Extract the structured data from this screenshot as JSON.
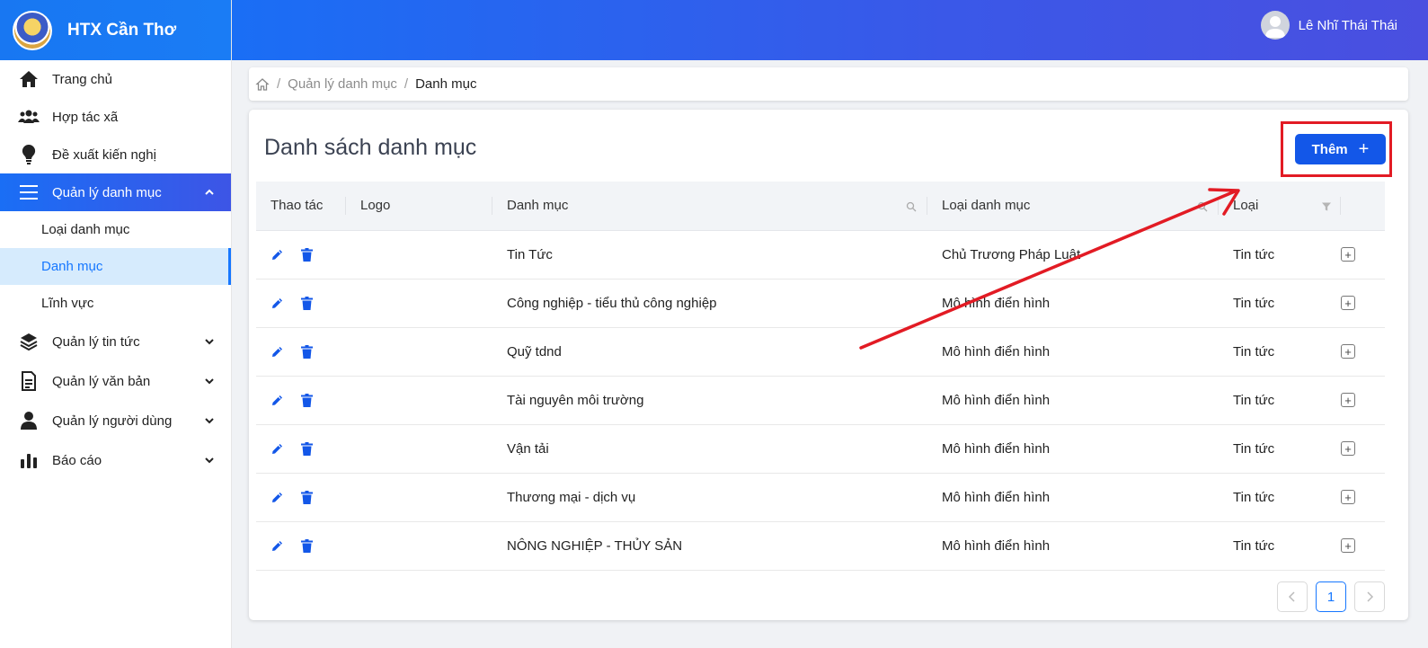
{
  "brand": {
    "title": "HTX Cần Thơ"
  },
  "user": {
    "name": "Lê Nhĩ Thái Thái"
  },
  "sidebar": {
    "items": [
      {
        "label": "Trang chủ",
        "icon": "home-icon"
      },
      {
        "label": "Hợp tác xã",
        "icon": "users-icon"
      },
      {
        "label": "Đề xuất kiến nghị",
        "icon": "lightbulb-icon"
      },
      {
        "label": "Quản lý danh mục",
        "icon": "menu-icon",
        "expanded": true,
        "children": [
          {
            "label": "Loại danh mục"
          },
          {
            "label": "Danh mục",
            "selected": true
          },
          {
            "label": "Lĩnh vực"
          }
        ]
      },
      {
        "label": "Quản lý tin tức",
        "icon": "layers-icon"
      },
      {
        "label": "Quản lý văn bản",
        "icon": "document-icon"
      },
      {
        "label": "Quản lý người dùng",
        "icon": "user-icon"
      },
      {
        "label": "Báo cáo",
        "icon": "bar-chart-icon"
      }
    ]
  },
  "breadcrumb": {
    "items": [
      "Quản lý danh mục",
      "Danh mục"
    ]
  },
  "main": {
    "title": "Danh sách danh mục",
    "add_label": "Thêm",
    "columns": [
      "Thao tác",
      "Logo",
      "Danh mục",
      "Loại danh mục",
      "Loại"
    ],
    "rows": [
      {
        "danh_muc": "Tin Tức",
        "loai_danh_muc": "Chủ Trương Pháp Luật",
        "loai": "Tin tức"
      },
      {
        "danh_muc": "Công nghiệp - tiểu thủ công nghiệp",
        "loai_danh_muc": "Mô hình điển hình",
        "loai": "Tin tức"
      },
      {
        "danh_muc": "Quỹ tdnd",
        "loai_danh_muc": "Mô hình điển hình",
        "loai": "Tin tức"
      },
      {
        "danh_muc": "Tài nguyên môi trường",
        "loai_danh_muc": "Mô hình điển hình",
        "loai": "Tin tức"
      },
      {
        "danh_muc": "Vận tải",
        "loai_danh_muc": "Mô hình điển hình",
        "loai": "Tin tức"
      },
      {
        "danh_muc": "Thương mại - dịch vụ",
        "loai_danh_muc": "Mô hình điển hình",
        "loai": "Tin tức"
      },
      {
        "danh_muc": "NÔNG NGHIỆP - THỦY SẢN",
        "loai_danh_muc": "Mô hình điển hình",
        "loai": "Tin tức"
      }
    ],
    "pagination": {
      "current": "1"
    }
  },
  "colors": {
    "primary": "#1357e8",
    "accent": "#1677ff",
    "annotation": "#e21b24"
  }
}
